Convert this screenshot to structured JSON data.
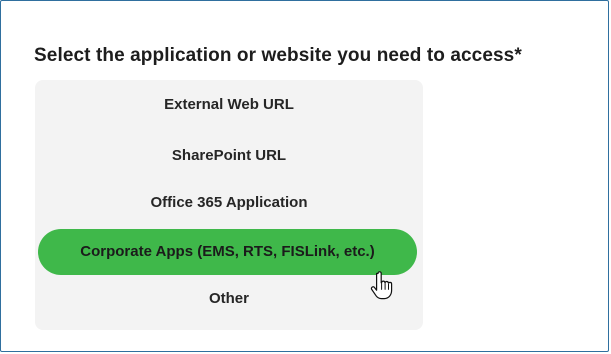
{
  "question": {
    "label": "Select the application or website you need to access*"
  },
  "options": [
    {
      "label": "External Web URL",
      "selected": false
    },
    {
      "label": "SharePoint URL",
      "selected": false
    },
    {
      "label": "Office 365 Application",
      "selected": false
    },
    {
      "label": "Corporate Apps (EMS, RTS, FISLink, etc.)",
      "selected": true
    },
    {
      "label": "Other",
      "selected": false
    }
  ],
  "colors": {
    "frame_border": "#2f6f9e",
    "panel_background": "#f3f3f3",
    "selected_background": "#3fb84a",
    "text": "#262626"
  },
  "cursor": {
    "icon": "hand-pointer-icon"
  }
}
